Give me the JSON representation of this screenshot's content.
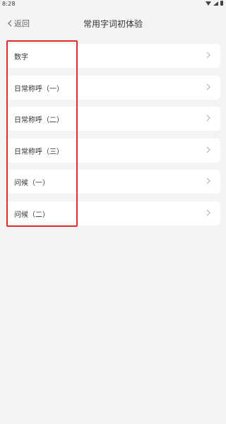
{
  "status_bar": {
    "time": "8:28",
    "icons": [
      "wifi-icon",
      "signal-icon",
      "battery-icon"
    ]
  },
  "nav": {
    "back_label": "返回",
    "title": "常用字词初体验"
  },
  "list": {
    "items": [
      {
        "label": "数字"
      },
      {
        "label": "日常称呼（一）"
      },
      {
        "label": "日常称呼（二）"
      },
      {
        "label": "日常称呼（三）"
      },
      {
        "label": "问候（一）"
      },
      {
        "label": "问候（二）"
      }
    ]
  },
  "colors": {
    "background": "#f4f4f4",
    "card": "#ffffff",
    "highlight": "#e12c2c",
    "chevron": "#b0b0b0"
  }
}
